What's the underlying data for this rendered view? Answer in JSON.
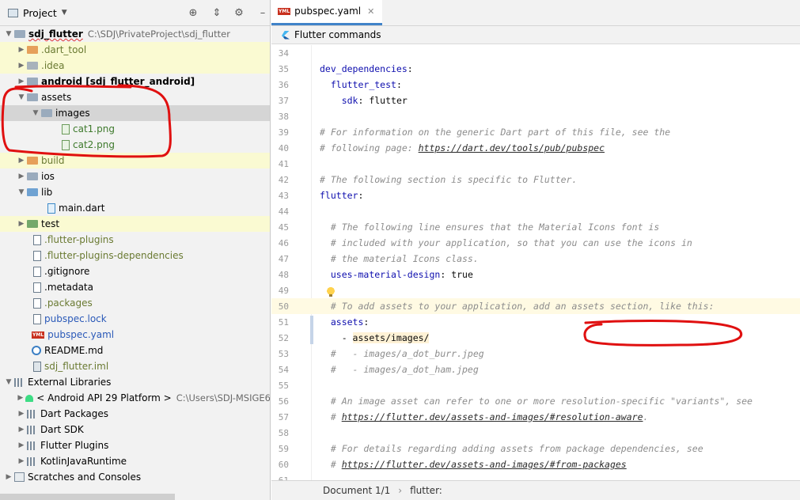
{
  "project_panel": {
    "title": "Project",
    "tree": [
      {
        "label": "sdj_flutter",
        "path": "C:\\SDJ\\PrivateProject\\sdj_flutter",
        "depth": 0,
        "expanded": true,
        "icon": "folder-icon"
      },
      {
        "label": ".dart_tool",
        "depth": 1,
        "expanded": false,
        "icon": "folder-icon"
      },
      {
        "label": ".idea",
        "depth": 1,
        "expanded": false,
        "icon": "folder-icon"
      },
      {
        "label": "android [sdj_flutter_android]",
        "depth": 1,
        "expanded": false,
        "icon": "folder-icon"
      },
      {
        "label": "assets",
        "depth": 1,
        "expanded": true,
        "icon": "folder-icon"
      },
      {
        "label": "images",
        "depth": 2,
        "expanded": true,
        "icon": "folder-icon"
      },
      {
        "label": "cat1.png",
        "depth": 3,
        "icon": "image-file-icon"
      },
      {
        "label": "cat2.png",
        "depth": 3,
        "icon": "image-file-icon"
      },
      {
        "label": "build",
        "depth": 1,
        "expanded": false,
        "icon": "folder-icon"
      },
      {
        "label": "ios",
        "depth": 1,
        "expanded": false,
        "icon": "folder-icon"
      },
      {
        "label": "lib",
        "depth": 1,
        "expanded": true,
        "icon": "folder-icon"
      },
      {
        "label": "main.dart",
        "depth": 2,
        "icon": "dart-file-icon"
      },
      {
        "label": "test",
        "depth": 1,
        "expanded": false,
        "icon": "folder-icon"
      },
      {
        "label": ".flutter-plugins",
        "depth": 1,
        "icon": "text-file-icon"
      },
      {
        "label": ".flutter-plugins-dependencies",
        "depth": 1,
        "icon": "text-file-icon"
      },
      {
        "label": ".gitignore",
        "depth": 1,
        "icon": "text-file-icon"
      },
      {
        "label": ".metadata",
        "depth": 1,
        "icon": "text-file-icon"
      },
      {
        "label": ".packages",
        "depth": 1,
        "icon": "text-file-icon"
      },
      {
        "label": "pubspec.lock",
        "depth": 1,
        "icon": "text-file-icon"
      },
      {
        "label": "pubspec.yaml",
        "depth": 1,
        "icon": "yaml-file-icon"
      },
      {
        "label": "README.md",
        "depth": 1,
        "icon": "markdown-file-icon"
      },
      {
        "label": "sdj_flutter.iml",
        "depth": 1,
        "icon": "module-file-icon"
      },
      {
        "label": "External Libraries",
        "depth": 0,
        "expanded": true,
        "icon": "library-icon"
      },
      {
        "label": "< Android API 29 Platform >",
        "path": "C:\\Users\\SDJ-MSIGE6",
        "depth": 1,
        "expanded": false,
        "icon": "android-icon"
      },
      {
        "label": "Dart Packages",
        "depth": 1,
        "expanded": false,
        "icon": "library-icon"
      },
      {
        "label": "Dart SDK",
        "depth": 1,
        "expanded": false,
        "icon": "library-icon"
      },
      {
        "label": "Flutter Plugins",
        "depth": 1,
        "expanded": false,
        "icon": "library-icon"
      },
      {
        "label": "KotlinJavaRuntime",
        "depth": 1,
        "expanded": false,
        "icon": "library-icon"
      },
      {
        "label": "Scratches and Consoles",
        "depth": 0,
        "expanded": false,
        "icon": "scratch-icon"
      }
    ]
  },
  "editor": {
    "tab": {
      "label": "pubspec.yaml",
      "badge": "YML"
    },
    "notification": "Flutter commands",
    "lines": [
      {
        "n": "34",
        "parts": [
          {
            "t": "",
            "s": "v"
          }
        ]
      },
      {
        "n": "35",
        "parts": [
          {
            "t": "dev_dependencies",
            "s": "k"
          },
          {
            "t": ":",
            "s": "v"
          }
        ]
      },
      {
        "n": "36",
        "parts": [
          {
            "t": "  ",
            "s": "v"
          },
          {
            "t": "flutter_test",
            "s": "k"
          },
          {
            "t": ":",
            "s": "v"
          }
        ]
      },
      {
        "n": "37",
        "parts": [
          {
            "t": "    ",
            "s": "v"
          },
          {
            "t": "sdk",
            "s": "k"
          },
          {
            "t": ": flutter",
            "s": "v"
          }
        ]
      },
      {
        "n": "38",
        "parts": [
          {
            "t": "",
            "s": "v"
          }
        ]
      },
      {
        "n": "39",
        "parts": [
          {
            "t": "# For information on the generic Dart part of this file, see the",
            "s": "c"
          }
        ]
      },
      {
        "n": "40",
        "parts": [
          {
            "t": "# following page: ",
            "s": "c"
          },
          {
            "t": "https://dart.dev/tools/pub/pubspec",
            "s": "u"
          }
        ]
      },
      {
        "n": "41",
        "parts": [
          {
            "t": "",
            "s": "v"
          }
        ]
      },
      {
        "n": "42",
        "parts": [
          {
            "t": "# The following section is specific to Flutter.",
            "s": "c"
          }
        ]
      },
      {
        "n": "43",
        "parts": [
          {
            "t": "flutter",
            "s": "k"
          },
          {
            "t": ":",
            "s": "v"
          }
        ]
      },
      {
        "n": "44",
        "parts": [
          {
            "t": "",
            "s": "v"
          }
        ]
      },
      {
        "n": "45",
        "parts": [
          {
            "t": "  # The following line ensures that the Material Icons font is",
            "s": "c"
          }
        ]
      },
      {
        "n": "46",
        "parts": [
          {
            "t": "  # included with your application, so that you can use the icons in",
            "s": "c"
          }
        ]
      },
      {
        "n": "47",
        "parts": [
          {
            "t": "  # the material Icons class.",
            "s": "c"
          }
        ]
      },
      {
        "n": "48",
        "parts": [
          {
            "t": "  ",
            "s": "v"
          },
          {
            "t": "uses-material-design",
            "s": "k"
          },
          {
            "t": ": true",
            "s": "v"
          }
        ]
      },
      {
        "n": "49",
        "parts": [
          {
            "t": "",
            "s": "v"
          }
        ]
      },
      {
        "n": "50",
        "parts": [
          {
            "t": "  # To add assets to your application, add an assets section, like this:",
            "s": "c"
          }
        ]
      },
      {
        "n": "51",
        "parts": [
          {
            "t": "  ",
            "s": "v"
          },
          {
            "t": "assets",
            "s": "k"
          },
          {
            "t": ":",
            "s": "v"
          }
        ]
      },
      {
        "n": "52",
        "parts": [
          {
            "t": "    - ",
            "s": "v"
          },
          {
            "t": "assets/images/",
            "s": "v hl"
          }
        ]
      },
      {
        "n": "53",
        "parts": [
          {
            "t": "  #   - images/a_dot_burr.jpeg",
            "s": "c"
          }
        ]
      },
      {
        "n": "54",
        "parts": [
          {
            "t": "  #   - images/a_dot_ham.jpeg",
            "s": "c"
          }
        ]
      },
      {
        "n": "55",
        "parts": [
          {
            "t": "",
            "s": "v"
          }
        ]
      },
      {
        "n": "56",
        "parts": [
          {
            "t": "  # An image asset can refer to one or more resolution-specific \"variants\", see",
            "s": "c"
          }
        ]
      },
      {
        "n": "57",
        "parts": [
          {
            "t": "  # ",
            "s": "c"
          },
          {
            "t": "https://flutter.dev/assets-and-images/#resolution-aware",
            "s": "u"
          },
          {
            "t": ".",
            "s": "c"
          }
        ]
      },
      {
        "n": "58",
        "parts": [
          {
            "t": "",
            "s": "v"
          }
        ]
      },
      {
        "n": "59",
        "parts": [
          {
            "t": "  # For details regarding adding assets from package dependencies, see",
            "s": "c"
          }
        ]
      },
      {
        "n": "60",
        "parts": [
          {
            "t": "  # ",
            "s": "c"
          },
          {
            "t": "https://flutter.dev/assets-and-images/#from-packages",
            "s": "u"
          }
        ]
      },
      {
        "n": "61",
        "parts": [
          {
            "t": "",
            "s": "v"
          }
        ]
      }
    ]
  },
  "statusbar": {
    "document": "Document 1/1",
    "breadcrumb_sep": "›",
    "crumb": "flutter:"
  },
  "colors": {
    "annotation_red": "#e01010",
    "selection_grey": "#d5d5d5",
    "excluded_yellow": "#fafad2"
  }
}
